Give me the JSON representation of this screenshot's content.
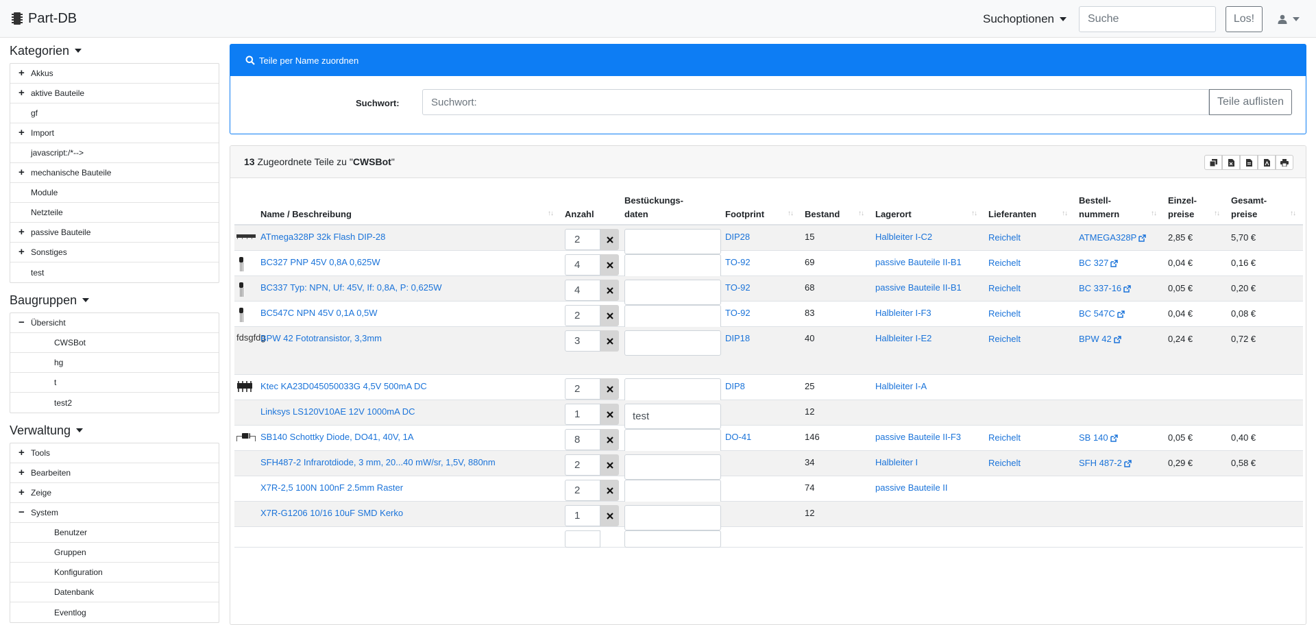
{
  "navbar": {
    "brand": "Part-DB",
    "search_options": "Suchoptionen",
    "search_placeholder": "Suche",
    "go_button": "Los!"
  },
  "sidebar": {
    "kategorien_title": "Kategorien",
    "kategorien": [
      {
        "label": "Akkus",
        "expand": "+"
      },
      {
        "label": "aktive Bauteile",
        "expand": "+"
      },
      {
        "label": "gf",
        "expand": ""
      },
      {
        "label": "Import",
        "expand": "+"
      },
      {
        "label": "javascript:/*-->",
        "expand": ""
      },
      {
        "label": "mechanische Bauteile",
        "expand": "+"
      },
      {
        "label": "Module",
        "expand": ""
      },
      {
        "label": "Netzteile",
        "expand": ""
      },
      {
        "label": "passive Bauteile",
        "expand": "+"
      },
      {
        "label": "Sonstiges",
        "expand": "+"
      },
      {
        "label": "test",
        "expand": ""
      }
    ],
    "baugruppen_title": "Baugruppen",
    "baugruppen": [
      {
        "label": "Übersicht",
        "expand": "−"
      },
      {
        "label": "CWSBot",
        "expand": ""
      },
      {
        "label": "hg",
        "expand": ""
      },
      {
        "label": "t",
        "expand": ""
      },
      {
        "label": "test2",
        "expand": ""
      }
    ],
    "verwaltung_title": "Verwaltung",
    "verwaltung": [
      {
        "label": "Tools",
        "expand": "+"
      },
      {
        "label": "Bearbeiten",
        "expand": "+"
      },
      {
        "label": "Zeige",
        "expand": "+"
      },
      {
        "label": "System",
        "expand": "−"
      },
      {
        "label": "Benutzer",
        "expand": ""
      },
      {
        "label": "Gruppen",
        "expand": ""
      },
      {
        "label": "Konfiguration",
        "expand": ""
      },
      {
        "label": "Datenbank",
        "expand": ""
      },
      {
        "label": "Eventlog",
        "expand": ""
      }
    ]
  },
  "assign": {
    "header": "Teile per Name zuordnen",
    "label": "Suchwort:",
    "placeholder": "Suchwort:",
    "button": "Teile auflisten"
  },
  "results": {
    "count": "13",
    "text": " Zugeordnete Teile zu \"",
    "project": "CWSBot",
    "quote_end": "\""
  },
  "table": {
    "headers": {
      "name": "Name / Beschreibung",
      "qty": "Anzahl",
      "mount1": "Bestückungs-",
      "mount2": "daten",
      "footprint": "Footprint",
      "stock": "Bestand",
      "location": "Lagerort",
      "supplier": "Lieferanten",
      "order1": "Bestell-",
      "order2": "nummern",
      "price1a": "Einzel-",
      "price1b": "preise",
      "price2a": "Gesamt-",
      "price2b": "preise"
    },
    "rows": [
      {
        "name": "ATmega328P 32k Flash DIP-28",
        "qty": "2",
        "mount": "",
        "footprint": "DIP28",
        "stock": "15",
        "location": "Halbleiter I-C2",
        "supplier": "Reichelt",
        "order": "ATMEGA328P",
        "price": "2,85 €",
        "total": "5,70 €",
        "thumb": "dip-long"
      },
      {
        "name": "BC327 PNP 45V 0,8A 0,625W",
        "qty": "4",
        "mount": "",
        "footprint": "TO-92",
        "stock": "69",
        "location": "passive Bauteile II-B1",
        "supplier": "Reichelt",
        "order": "BC 327",
        "price": "0,04 €",
        "total": "0,16 €",
        "thumb": "transistor"
      },
      {
        "name": "BC337 Typ: NPN, Uf: 45V, If: 0,8A, P: 0,625W",
        "qty": "4",
        "mount": "",
        "footprint": "TO-92",
        "stock": "68",
        "location": "passive Bauteile II-B1",
        "supplier": "Reichelt",
        "order": "BC 337-16",
        "price": "0,05 €",
        "total": "0,20 €",
        "thumb": "transistor"
      },
      {
        "name": "BC547C NPN 45V 0,1A 0,5W",
        "qty": "2",
        "mount": "",
        "footprint": "TO-92",
        "stock": "83",
        "location": "Halbleiter I-F3",
        "supplier": "Reichelt",
        "order": "BC 547C",
        "price": "0,04 €",
        "total": "0,08 €",
        "thumb": "transistor"
      },
      {
        "name": "BPW 42 Fototransistor, 3,3mm",
        "qty": "3",
        "mount": "",
        "footprint": "DIP18",
        "stock": "40",
        "location": "Halbleiter I-E2",
        "supplier": "Reichelt",
        "order": "BPW 42",
        "price": "0,24 €",
        "total": "0,72 €",
        "thumb": "broken",
        "alt": "fdsgfdg"
      },
      {
        "name": "Ktec KA23D045050033G 4,5V 500mA DC",
        "qty": "2",
        "mount": "",
        "footprint": "DIP8",
        "stock": "25",
        "location": "Halbleiter I-A",
        "supplier": "",
        "order": "",
        "price": "",
        "total": "",
        "thumb": "dip8"
      },
      {
        "name": "Linksys LS120V10AE 12V 1000mA DC",
        "qty": "1",
        "mount": "test",
        "footprint": "",
        "stock": "12",
        "location": "",
        "supplier": "",
        "order": "",
        "price": "",
        "total": "",
        "thumb": ""
      },
      {
        "name": "SB140 Schottky Diode, DO41, 40V, 1A",
        "qty": "8",
        "mount": "",
        "footprint": "DO-41",
        "stock": "146",
        "location": "passive Bauteile II-F3",
        "supplier": "Reichelt",
        "order": "SB 140",
        "price": "0,05 €",
        "total": "0,40 €",
        "thumb": "diode"
      },
      {
        "name": "SFH487-2 Infrarotdiode, 3 mm, 20...40 mW/sr, 1,5V, 880nm",
        "qty": "2",
        "mount": "",
        "footprint": "",
        "stock": "34",
        "location": "Halbleiter I",
        "supplier": "Reichelt",
        "order": "SFH 487-2",
        "price": "0,29 €",
        "total": "0,58 €",
        "thumb": ""
      },
      {
        "name": "X7R-2,5 100N 100nF 2.5mm Raster",
        "qty": "2",
        "mount": "",
        "footprint": "",
        "stock": "74",
        "location": "passive Bauteile II",
        "supplier": "",
        "order": "",
        "price": "",
        "total": "",
        "thumb": ""
      },
      {
        "name": "X7R-G1206 10/16 10uF SMD Kerko",
        "qty": "1",
        "mount": "",
        "footprint": "",
        "stock": "12",
        "location": "",
        "supplier": "",
        "order": "",
        "price": "",
        "total": "",
        "thumb": ""
      },
      {
        "name": "",
        "qty": "",
        "mount": "",
        "footprint": "",
        "stock": "",
        "location": "",
        "supplier": "",
        "order": "",
        "price": "",
        "total": "",
        "thumb": ""
      }
    ]
  }
}
